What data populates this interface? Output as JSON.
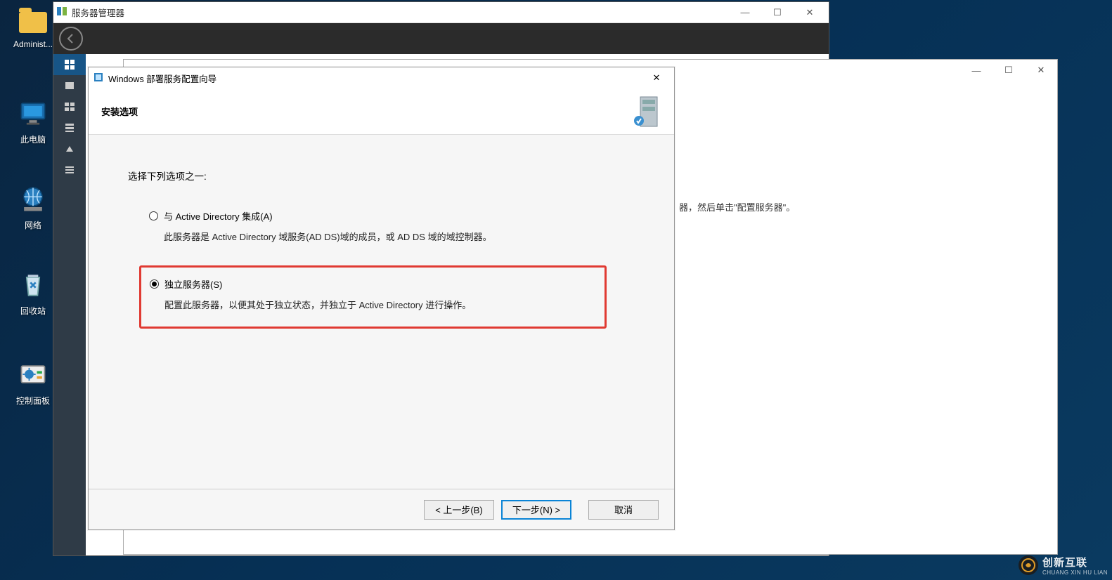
{
  "desktop": {
    "icons": [
      {
        "label": "Administ..."
      },
      {
        "label": "此电脑"
      },
      {
        "label": "网络"
      },
      {
        "label": "回收站"
      },
      {
        "label": "控制面板"
      }
    ]
  },
  "server_manager": {
    "title": "服务器管理器",
    "win": {
      "min": "—",
      "max": "☐",
      "close": "✕"
    }
  },
  "mmc_window": {
    "body_hint": "器，然后单击\"配置服务器\"。"
  },
  "wizard": {
    "title": "Windows 部署服务配置向导",
    "close": "✕",
    "subtitle": "安装选项",
    "prompt": "选择下列选项之一:",
    "options": [
      {
        "label": "与 Active Directory 集成(A)",
        "desc": "此服务器是 Active Directory 域服务(AD DS)域的成员，或 AD DS 域的域控制器。",
        "checked": false
      },
      {
        "label": "独立服务器(S)",
        "desc": "配置此服务器，以便其处于独立状态，并独立于 Active Directory 进行操作。",
        "checked": true
      }
    ],
    "footer": {
      "back": "< 上一步(B)",
      "next": "下一步(N) >",
      "cancel": "取消"
    }
  },
  "watermark": {
    "line1": "创新互联",
    "line2": "CHUANG XIN HU LIAN"
  }
}
